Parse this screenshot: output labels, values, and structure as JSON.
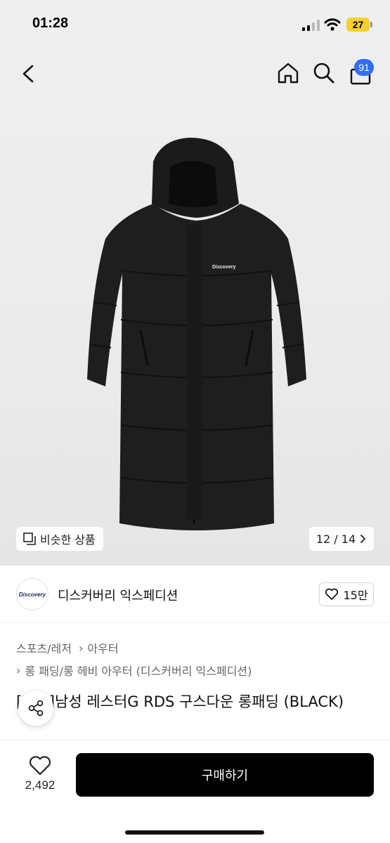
{
  "status_bar": {
    "time": "01:28",
    "battery": "27"
  },
  "nav": {
    "cart_count": "91"
  },
  "image": {
    "similar_label": "비슷한 상품",
    "counter": "12 / 14",
    "brand_text": "Discovery"
  },
  "store": {
    "name": "디스커버리 익스페디션",
    "logo_text": "Discovery",
    "likes": "15만"
  },
  "breadcrumb": {
    "level1": "스포츠/레저",
    "level2": "아우터",
    "level3": "롱 패딩/롱 헤비 아우터 (디스커버리 익스페디션)"
  },
  "product": {
    "title": "[반품]남성 레스터G RDS 구스다운 롱패딩 (BLACK)"
  },
  "bottom": {
    "wish_count": "2,492",
    "buy_label": "구매하기"
  },
  "colors": {
    "accent_badge": "#2f6df6",
    "buy_button": "#000000",
    "battery": "#f7cf2e"
  },
  "icons": [
    "back-icon",
    "home-icon",
    "search-icon",
    "cart-icon",
    "similar-icon",
    "chevron-right-icon",
    "heart-icon",
    "share-icon"
  ]
}
